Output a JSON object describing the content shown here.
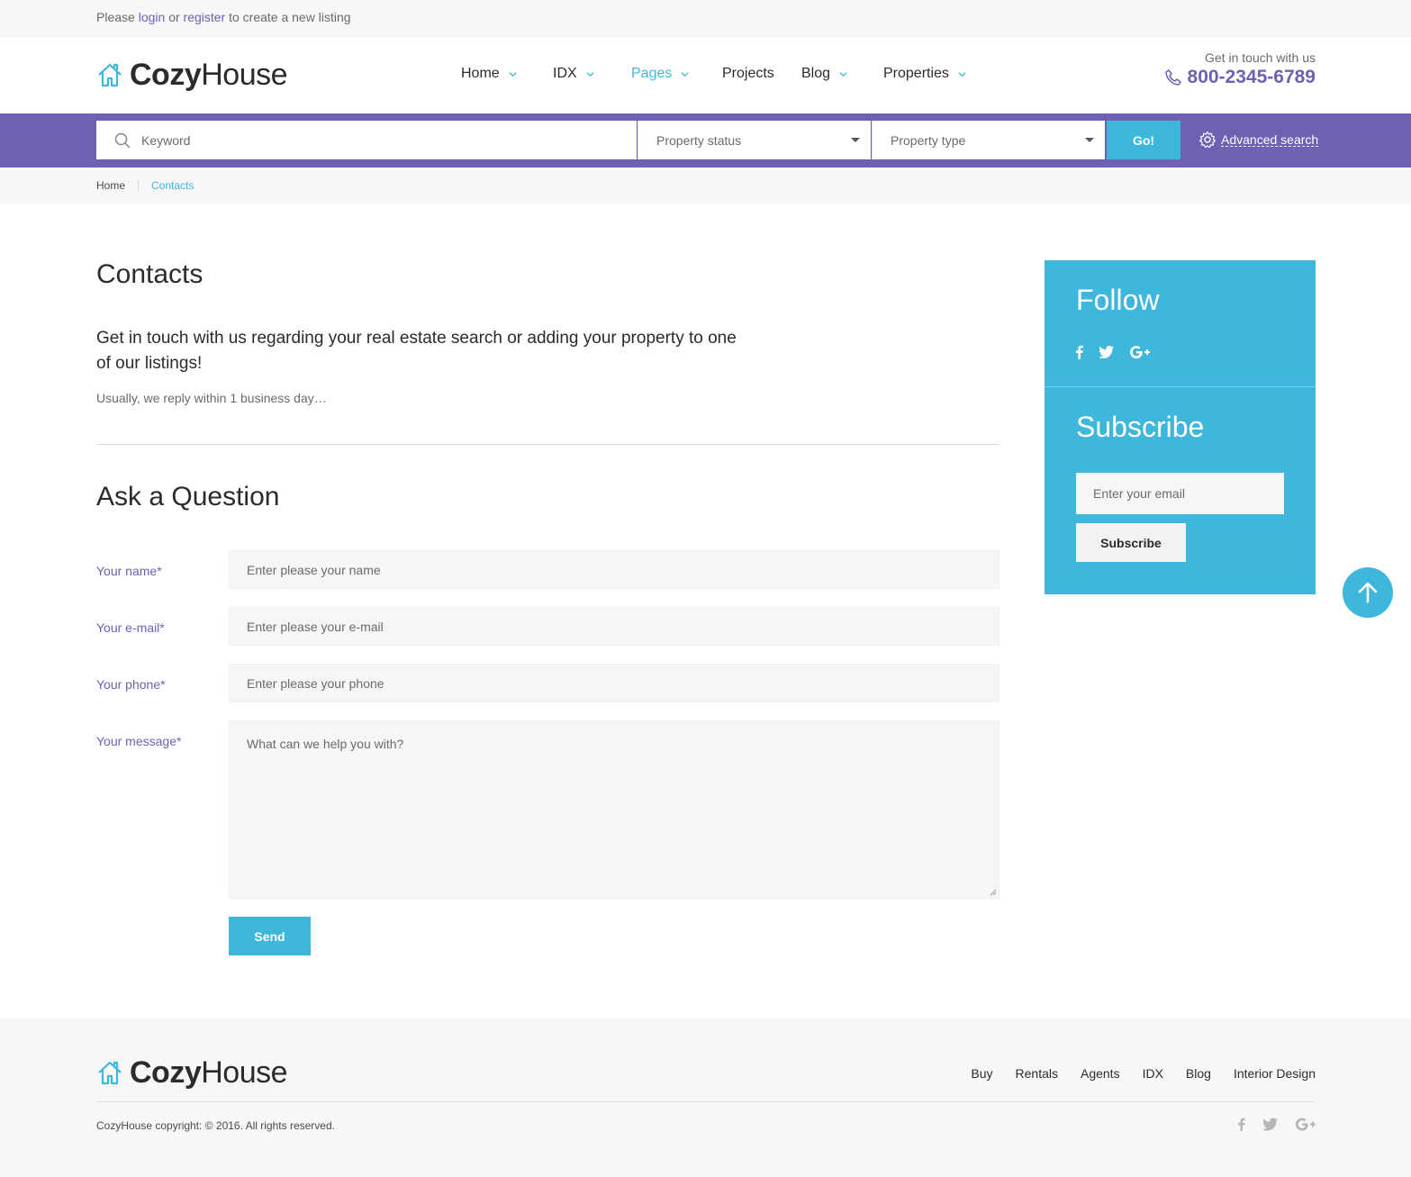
{
  "topbar": {
    "prefix": "Please",
    "login": "login",
    "or": "or",
    "register": "register",
    "suffix": "to create a new listing"
  },
  "brand": {
    "bold": "Cozy",
    "light": "House",
    "accent": "#3fb6dc",
    "primary": "#6d62b2"
  },
  "nav": {
    "items": [
      {
        "label": "Home",
        "dropdown": true
      },
      {
        "label": "IDX",
        "dropdown": true
      },
      {
        "label": "Pages",
        "dropdown": true,
        "active": true
      },
      {
        "label": "Projects",
        "dropdown": false
      },
      {
        "label": "Blog",
        "dropdown": true
      },
      {
        "label": "Properties",
        "dropdown": true
      }
    ]
  },
  "contact": {
    "caption": "Get in touch with us",
    "phone": "800-2345-6789",
    "icon": "phone-icon"
  },
  "search": {
    "keyword_placeholder": "Keyword",
    "status_label": "Property status",
    "type_label": "Property type",
    "go_label": "Go!",
    "advanced_label": "Advanced search"
  },
  "breadcrumb": {
    "home": "Home",
    "current": "Contacts"
  },
  "main": {
    "title": "Contacts",
    "lead": "Get in touch with us regarding your real estate search or adding your property to one of our listings!",
    "note": "Usually, we reply within 1 business day…",
    "form_title": "Ask a Question",
    "fields": {
      "name": {
        "label": "Your name*",
        "placeholder": "Enter please your name"
      },
      "email": {
        "label": "Your e-mail*",
        "placeholder": "Enter please your e-mail"
      },
      "phone": {
        "label": "Your phone*",
        "placeholder": "Enter please your phone"
      },
      "message": {
        "label": "Your message*",
        "placeholder": "What can we help you with?"
      }
    },
    "send_label": "Send"
  },
  "sidebar": {
    "follow_title": "Follow",
    "socials": [
      "facebook-icon",
      "twitter-icon",
      "google-plus-icon"
    ],
    "subscribe_title": "Subscribe",
    "email_placeholder": "Enter your email",
    "subscribe_label": "Subscribe"
  },
  "footer": {
    "links": [
      "Buy",
      "Rentals",
      "Agents",
      "IDX",
      "Blog",
      "Interior Design"
    ],
    "copyright": "CozyHouse copyright: © 2016. All rights reserved."
  }
}
